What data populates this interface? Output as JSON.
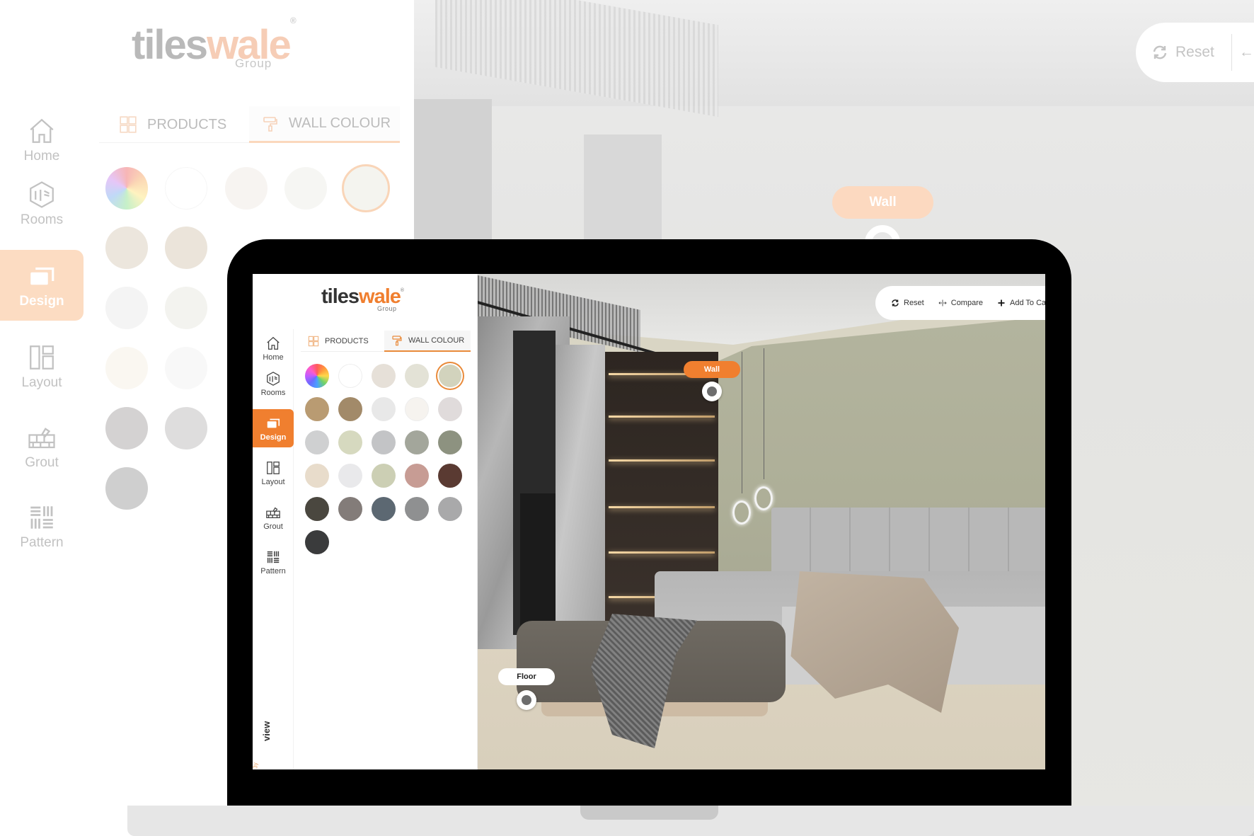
{
  "background_app": {
    "logo": {
      "word1": "tiles",
      "word2": "wale",
      "registered": "®",
      "group": "Group"
    },
    "rail": [
      {
        "label": "Home",
        "icon": "home-icon"
      },
      {
        "label": "Rooms",
        "icon": "rooms-icon"
      },
      {
        "label": "Design",
        "icon": "design-icon",
        "active": true
      },
      {
        "label": "Layout",
        "icon": "layout-icon"
      },
      {
        "label": "Grout",
        "icon": "grout-icon"
      },
      {
        "label": "Pattern",
        "icon": "pattern-icon"
      }
    ],
    "tabs": [
      {
        "label": "PRODUCTS",
        "icon": "grid-icon"
      },
      {
        "label": "WALL COLOUR",
        "icon": "paint-roller-icon",
        "active": true
      }
    ],
    "toolbar": {
      "reset_label": "Reset"
    },
    "hotspot": {
      "wall_label": "Wall"
    }
  },
  "app": {
    "logo": {
      "word1": "tiles",
      "word2": "wale",
      "registered": "®",
      "group": "Group"
    },
    "rail": [
      {
        "label": "Home",
        "icon": "home-icon"
      },
      {
        "label": "Rooms",
        "icon": "rooms-icon"
      },
      {
        "label": "Design",
        "icon": "design-icon",
        "active": true
      },
      {
        "label": "Layout",
        "icon": "layout-icon"
      },
      {
        "label": "Grout",
        "icon": "grout-icon"
      },
      {
        "label": "Pattern",
        "icon": "pattern-icon"
      }
    ],
    "tabs": [
      {
        "label": "PRODUCTS",
        "icon": "grid-icon"
      },
      {
        "label": "WALL COLOUR",
        "icon": "paint-roller-icon",
        "active": true
      }
    ],
    "swatches": [
      {
        "name": "custom-colour-wheel",
        "color": "conic"
      },
      {
        "name": "white",
        "color": "#ffffff"
      },
      {
        "name": "linen",
        "color": "#e6e0d8"
      },
      {
        "name": "pale-sage-cream",
        "color": "#e3e2d6"
      },
      {
        "name": "sage-selected",
        "color": "#d2d3bd",
        "selected": true
      },
      {
        "name": "caramel",
        "color": "#b99b72"
      },
      {
        "name": "mocha",
        "color": "#a28a69"
      },
      {
        "name": "cloud-grey",
        "color": "#e8e8e8"
      },
      {
        "name": "ivory",
        "color": "#f6f3ef"
      },
      {
        "name": "mist-pink-grey",
        "color": "#e0dbdb"
      },
      {
        "name": "silver",
        "color": "#cfd0d1"
      },
      {
        "name": "pistachio-cream",
        "color": "#d6d9bf"
      },
      {
        "name": "ash-grey",
        "color": "#c3c4c6"
      },
      {
        "name": "stone-grey",
        "color": "#a3a69b"
      },
      {
        "name": "olive-grey",
        "color": "#8d9280"
      },
      {
        "name": "sand",
        "color": "#e8dccb"
      },
      {
        "name": "frost",
        "color": "#e9e9eb"
      },
      {
        "name": "sage",
        "color": "#cccfb4"
      },
      {
        "name": "dusty-rose",
        "color": "#c79c94"
      },
      {
        "name": "chocolate",
        "color": "#5a3a32"
      },
      {
        "name": "charcoal-brown",
        "color": "#4a473f"
      },
      {
        "name": "taupe-grey",
        "color": "#837c79"
      },
      {
        "name": "slate-blue",
        "color": "#5c6872"
      },
      {
        "name": "mid-grey",
        "color": "#8f9091"
      },
      {
        "name": "light-grey",
        "color": "#a9a9aa"
      },
      {
        "name": "graphite",
        "color": "#3a3b3c"
      }
    ],
    "toolbar": {
      "reset_label": "Reset",
      "compare_label": "Compare",
      "add_to_cart_label": "Add To Ca"
    },
    "hotspots": {
      "wall_label": "Wall",
      "floor_label": "Floor"
    },
    "vertical_label": "view",
    "vertical_label_small": "3y"
  },
  "colors": {
    "accent": "#f07f2f",
    "wall_paint": "#b3b49e"
  }
}
